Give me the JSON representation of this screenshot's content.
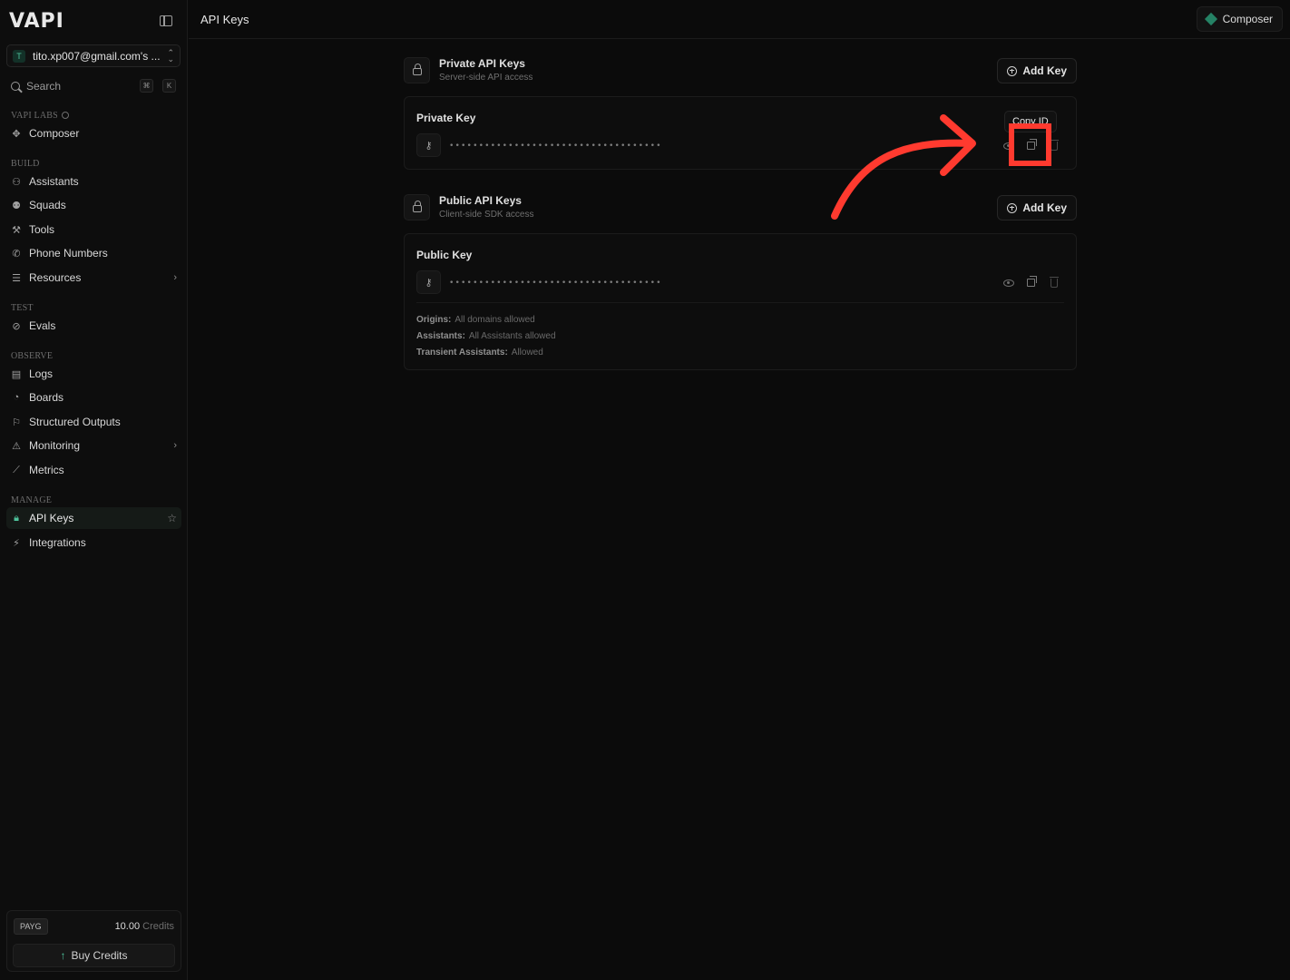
{
  "sidebar": {
    "logo": "VAPI",
    "org": {
      "avatar": "T",
      "name": "tito.xp007@gmail.com's ..."
    },
    "search": {
      "placeholder": "Search",
      "kbd1": "⌘",
      "kbd2": "K"
    },
    "sections": {
      "labs": "VAPI LABS",
      "build": "BUILD",
      "test": "TEST",
      "observe": "OBSERVE",
      "manage": "MANAGE"
    },
    "items": {
      "composer": "Composer",
      "assistants": "Assistants",
      "squads": "Squads",
      "tools": "Tools",
      "phone_numbers": "Phone Numbers",
      "resources": "Resources",
      "evals": "Evals",
      "logs": "Logs",
      "boards": "Boards",
      "structured_outputs": "Structured Outputs",
      "monitoring": "Monitoring",
      "metrics": "Metrics",
      "api_keys": "API Keys",
      "integrations": "Integrations"
    },
    "credits": {
      "plan": "PAYG",
      "amount": "10.00",
      "unit": "Credits",
      "buy_label": "Buy Credits"
    }
  },
  "topbar": {
    "title": "API Keys",
    "composer_label": "Composer"
  },
  "private_section": {
    "title": "Private API Keys",
    "subtitle": "Server-side API access",
    "add_label": "Add Key",
    "card": {
      "title": "Private Key",
      "masked": "••••••••••••••••••••••••••••••••••••",
      "tooltip": "Copy ID"
    }
  },
  "public_section": {
    "title": "Public API Keys",
    "subtitle": "Client-side SDK access",
    "add_label": "Add Key",
    "card": {
      "title": "Public Key",
      "masked": "••••••••••••••••••••••••••••••••••••",
      "origins_label": "Origins:",
      "origins_value": "All domains allowed",
      "assistants_label": "Assistants:",
      "assistants_value": "All Assistants allowed",
      "transient_label": "Transient Assistants:",
      "transient_value": "Allowed"
    }
  },
  "colors": {
    "accent": "#4ec29b",
    "annotation": "#ff3a2f",
    "background": "#0b0b0b"
  }
}
